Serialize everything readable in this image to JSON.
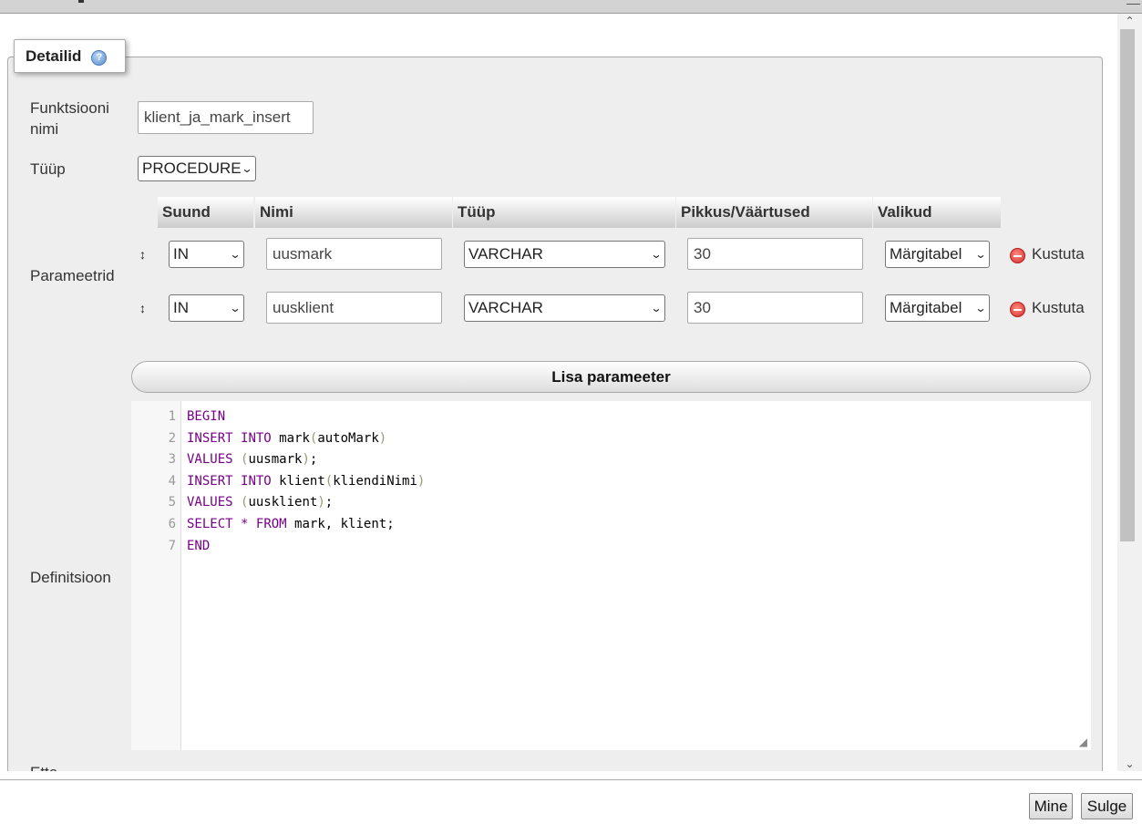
{
  "panel": {
    "legend": "Detailid",
    "help_icon": "help-icon"
  },
  "fields": {
    "function_name_label_1": "Funktsiooni",
    "function_name_label_2": "nimi",
    "function_name_value": "klient_ja_mark_insert",
    "type_label": "Tüüp",
    "type_value": "PROCEDURE",
    "params_label": "Parameetrid",
    "definition_label": "Definitsioon",
    "cut_label": "Ette"
  },
  "params": {
    "headers": {
      "direction": "Suund",
      "name": "Nimi",
      "type": "Tüüp",
      "length": "Pikkus/Väärtused",
      "options": "Valikud"
    },
    "rows": [
      {
        "direction": "IN",
        "name": "uusmark",
        "type": "VARCHAR",
        "length": "30",
        "options": "Märgitabel",
        "delete": "Kustuta"
      },
      {
        "direction": "IN",
        "name": "uusklient",
        "type": "VARCHAR",
        "length": "30",
        "options": "Märgitabel",
        "delete": "Kustuta"
      }
    ],
    "add_button": "Lisa parameeter"
  },
  "editor": {
    "line_numbers": [
      "1",
      "2",
      "3",
      "4",
      "5",
      "6",
      "7"
    ],
    "lines": {
      "l1": {
        "kw1": "BEGIN"
      },
      "l2": {
        "kw1": "INSERT",
        "kw2": "INTO",
        "ident": "mark",
        "open": "(",
        "arg": "autoMark",
        "close": ")"
      },
      "l3": {
        "kw1": "VALUES",
        "open": "(",
        "arg": "uusmark",
        "close": ")",
        "end": ";"
      },
      "l4": {
        "kw1": "INSERT",
        "kw2": "INTO",
        "ident": "klient",
        "open": "(",
        "arg": "kliendiNimi",
        "close": ")"
      },
      "l5": {
        "kw1": "VALUES",
        "open": "(",
        "arg": "uusklient",
        "close": ")",
        "end": ";"
      },
      "l6": {
        "kw1": "SELECT",
        "star": "*",
        "kw2": "FROM",
        "rest": "mark, klient;"
      },
      "l7": {
        "kw1": "END"
      }
    }
  },
  "footer": {
    "go_button": "Mine",
    "close_button": "Sulge"
  }
}
